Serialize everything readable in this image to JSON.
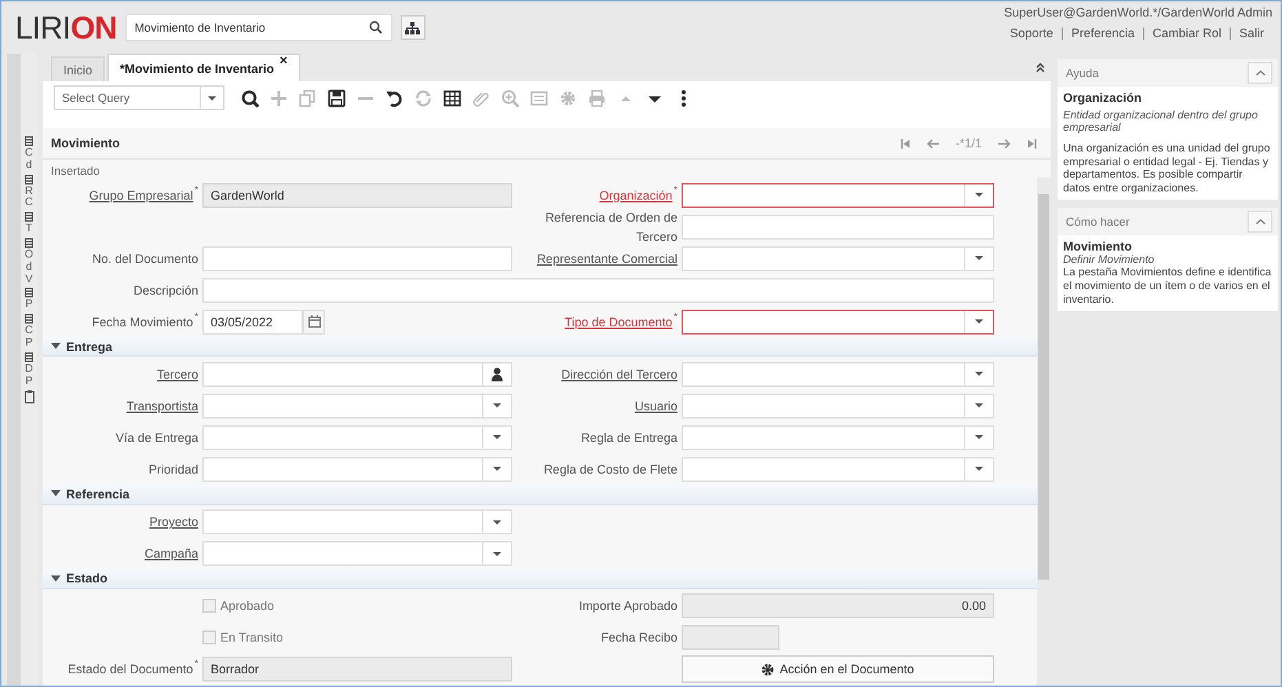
{
  "header": {
    "logo": {
      "dark": "LIRI",
      "accent": "ON"
    },
    "search": {
      "value": "Movimiento de Inventario"
    },
    "user": "SuperUser@GardenWorld.*/GardenWorld Admin",
    "links": [
      "Soporte",
      "Preferencia",
      "Cambiar Rol",
      "Salir"
    ]
  },
  "side_menu": {
    "items": [
      {
        "letters": "Cd"
      },
      {
        "letters": "RC"
      },
      {
        "letters": "T"
      },
      {
        "letters": "ÓdV"
      },
      {
        "letters": "P"
      },
      {
        "letters": "CP"
      },
      {
        "letters": "DP"
      }
    ]
  },
  "tabs": [
    {
      "label": "Inicio",
      "selected": false,
      "closable": false
    },
    {
      "label": "*Movimiento de Inventario",
      "selected": true,
      "closable": true,
      "close": "×"
    }
  ],
  "toolbar": {
    "query": {
      "placeholder": "Select Query"
    },
    "buttons": [
      {
        "kind": "search",
        "enabled": true
      },
      {
        "kind": "new",
        "enabled": false
      },
      {
        "kind": "copy",
        "enabled": false
      },
      {
        "kind": "save",
        "enabled": true
      },
      {
        "kind": "delete",
        "enabled": false
      },
      {
        "kind": "undo",
        "enabled": true
      },
      {
        "kind": "refresh",
        "enabled": false
      },
      {
        "kind": "grid",
        "enabled": true
      },
      {
        "kind": "attach",
        "enabled": false
      },
      {
        "kind": "zoom",
        "enabled": false
      },
      {
        "kind": "report",
        "enabled": false
      },
      {
        "kind": "gear",
        "enabled": false
      },
      {
        "kind": "print",
        "enabled": false
      },
      {
        "kind": "up",
        "enabled": false
      },
      {
        "kind": "down",
        "enabled": true
      },
      {
        "kind": "more",
        "enabled": true
      }
    ]
  },
  "record": {
    "title": "Movimiento",
    "counter": "-*1/1",
    "status": "Insertado"
  },
  "form": {
    "sections": [
      {
        "rows": [
          [
            {
              "label": "Grupo Empresarial",
              "mark": "*",
              "link": true,
              "error": false,
              "kind": "readonly",
              "value": "GardenWorld"
            },
            {
              "label": "Organización",
              "mark": "*",
              "link": true,
              "error": true,
              "kind": "select"
            }
          ],
          [
            null,
            {
              "label": "Referencia de Orden de Tercero",
              "link": false,
              "error": false,
              "kind": "text"
            }
          ],
          [
            {
              "label": "No. del Documento",
              "link": false,
              "error": false,
              "kind": "text"
            },
            {
              "label": "Representante Comercial",
              "link": true,
              "error": false,
              "kind": "select"
            }
          ],
          [
            {
              "label": "Descripción",
              "link": false,
              "error": false,
              "kind": "text",
              "wide": true
            }
          ],
          [
            {
              "label": "Fecha Movimiento",
              "mark": "*",
              "link": false,
              "error": false,
              "kind": "date",
              "value": "03/05/2022"
            },
            {
              "label": "Tipo de Documento",
              "mark": "*",
              "link": true,
              "error": true,
              "kind": "select"
            }
          ]
        ]
      },
      {
        "title": "Entrega",
        "expanded": true,
        "rows": [
          [
            {
              "label": "Tercero",
              "link": true,
              "error": false,
              "kind": "search"
            },
            {
              "label": "Dirección del Tercero",
              "link": true,
              "error": false,
              "kind": "select"
            }
          ],
          [
            {
              "label": "Transportista",
              "link": true,
              "error": false,
              "kind": "select"
            },
            {
              "label": "Usuario",
              "link": true,
              "error": false,
              "kind": "select"
            }
          ],
          [
            {
              "label": "Vía de Entrega",
              "link": false,
              "error": false,
              "kind": "select"
            },
            {
              "label": "Regla de Entrega",
              "link": false,
              "error": false,
              "kind": "select"
            }
          ],
          [
            {
              "label": "Prioridad",
              "link": false,
              "error": false,
              "kind": "select"
            },
            {
              "label": "Regla de Costo de Flete",
              "link": false,
              "error": false,
              "kind": "select"
            }
          ]
        ]
      },
      {
        "title": "Referencia",
        "expanded": true,
        "rows": [
          [
            {
              "label": "Proyecto",
              "link": true,
              "error": false,
              "kind": "select"
            },
            null
          ],
          [
            {
              "label": "Campaña",
              "link": true,
              "error": false,
              "kind": "select"
            },
            null
          ]
        ]
      },
      {
        "title": "Estado",
        "expanded": true,
        "rows": [
          [
            {
              "label": "Aprobado",
              "kind": "checkbox",
              "checked": false,
              "disabled": true
            },
            {
              "label": "Importe Aprobado",
              "link": false,
              "error": false,
              "kind": "number",
              "value": "0.00"
            }
          ],
          [
            {
              "label": "En Transito",
              "kind": "checkbox",
              "checked": false,
              "disabled": true
            },
            {
              "label": "Fecha Recibo",
              "link": false,
              "error": false,
              "kind": "short"
            }
          ],
          [
            {
              "label": "Estado del Documento",
              "mark": "*",
              "link": false,
              "error": false,
              "kind": "readonly",
              "value": "Borrador"
            },
            {
              "kind": "button",
              "label": "Acción en el Documento"
            }
          ]
        ]
      }
    ]
  },
  "help": [
    {
      "title": "Ayuda",
      "heading": "Organización",
      "subtitle": "Entidad organizacional dentro del grupo empresarial",
      "body": "Una organización es una unidad del grupo empresarial o entidad legal - Ej. Tiendas y departamentos. Es posible compartir datos entre organizaciones."
    },
    {
      "title": "Cómo hacer",
      "heading": "Movimiento",
      "subtitle": "Definir Movimiento",
      "body": "La pestaña Movimientos define e identifica el movimiento de un ítem o de varios en el inventario."
    }
  ]
}
